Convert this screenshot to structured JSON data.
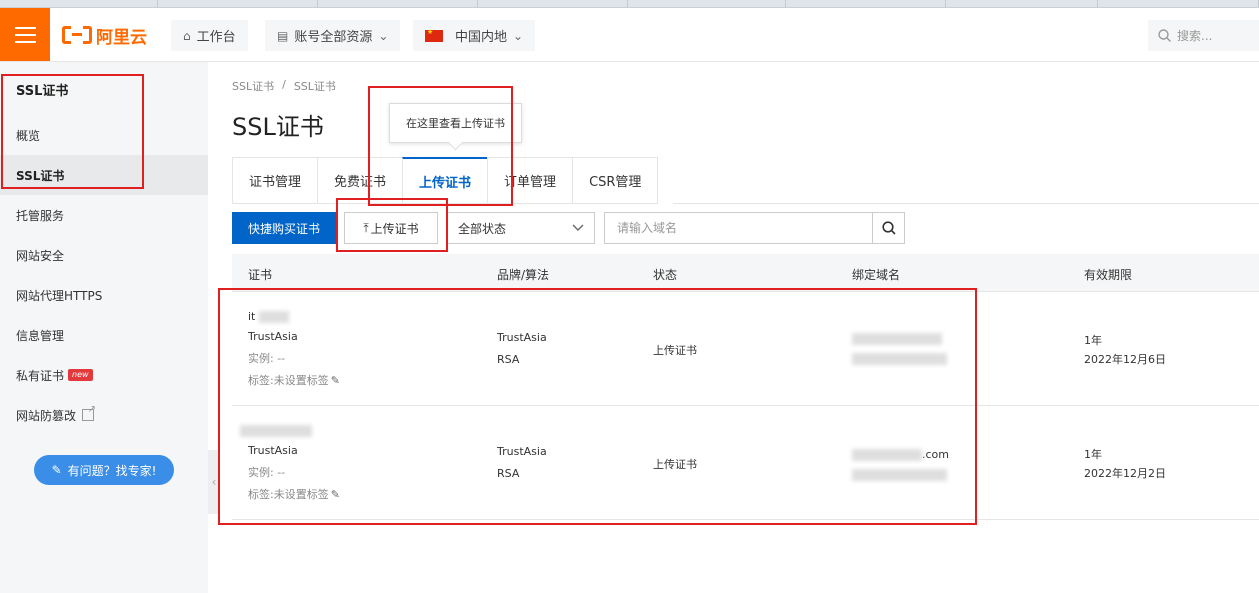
{
  "header": {
    "brand": "阿里云",
    "workspace": "工作台",
    "account_scope": "账号全部资源",
    "region": "中国内地",
    "search_placeholder": "搜索..."
  },
  "sidebar": {
    "title": "SSL证书",
    "items": [
      {
        "label": "概览"
      },
      {
        "label": "SSL证书"
      },
      {
        "label": "托管服务"
      },
      {
        "label": "网站安全"
      },
      {
        "label": "网站代理HTTPS"
      },
      {
        "label": "信息管理"
      },
      {
        "label": "私有证书",
        "badge": "new"
      },
      {
        "label": "网站防篡改"
      }
    ],
    "help_button": "有问题？找专家!"
  },
  "main": {
    "breadcrumb": [
      "SSL证书",
      "/",
      "SSL证书"
    ],
    "title": "SSL证书",
    "tooltip": "在这里查看上传证书",
    "tabs": [
      {
        "label": "证书管理"
      },
      {
        "label": "免费证书"
      },
      {
        "label": "上传证书",
        "active": true
      },
      {
        "label": "订单管理"
      },
      {
        "label": "CSR管理"
      }
    ],
    "toolbar": {
      "buy_button": "快捷购买证书",
      "upload_button": "上传证书",
      "status_select": "全部状态",
      "domain_placeholder": "请输入域名"
    },
    "table": {
      "columns": [
        "证书",
        "品牌/算法",
        "状态",
        "绑定域名",
        "有效期限"
      ],
      "rows": [
        {
          "cert_name": "it",
          "issuer": "TrustAsia",
          "instance": "实例: --",
          "tag": "标签:未设置标签",
          "brand": "TrustAsia",
          "algo": "RSA",
          "status": "上传证书",
          "domain_line1": "",
          "domain_line2": "",
          "term": "1年",
          "expiry": "2022年12月6日"
        },
        {
          "cert_name": "",
          "issuer": "TrustAsia",
          "instance": "实例: --",
          "tag": "标签:未设置标签",
          "brand": "TrustAsia",
          "algo": "RSA",
          "status": "上传证书",
          "domain_line1": ".com",
          "domain_line2": "",
          "term": "1年",
          "expiry": "2022年12月2日"
        }
      ]
    }
  }
}
